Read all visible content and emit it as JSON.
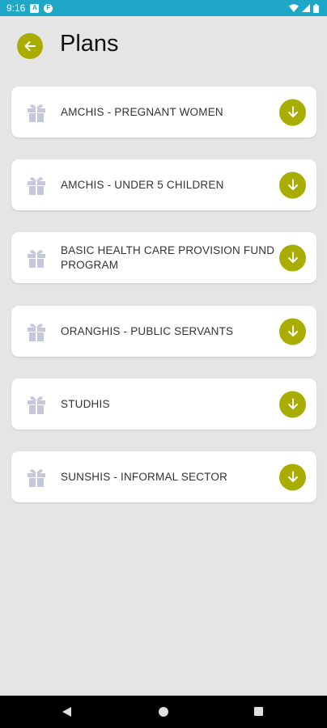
{
  "status_bar": {
    "time": "9:16",
    "notification_icons": [
      "a-badge-icon",
      "f-badge-icon"
    ],
    "system_icons": [
      "wifi-icon",
      "signal-icon",
      "battery-icon"
    ]
  },
  "header": {
    "title": "Plans",
    "back_icon": "arrow-left-icon"
  },
  "plans": [
    {
      "label": "AMCHIS - PREGNANT WOMEN"
    },
    {
      "label": "AMCHIS - UNDER 5 CHILDREN"
    },
    {
      "label": "BASIC HEALTH CARE PROVISION FUND PROGRAM"
    },
    {
      "label": "ORANGHIS - PUBLIC SERVANTS"
    },
    {
      "label": "STUDHIS"
    },
    {
      "label": "SUNSHIS - INFORMAL SECTOR"
    }
  ],
  "colors": {
    "accent": "#a8ad00",
    "status_bar": "#1ea7c6",
    "background": "#e5e5e5",
    "card": "#ffffff",
    "gift_icon": "#c5c8da"
  }
}
